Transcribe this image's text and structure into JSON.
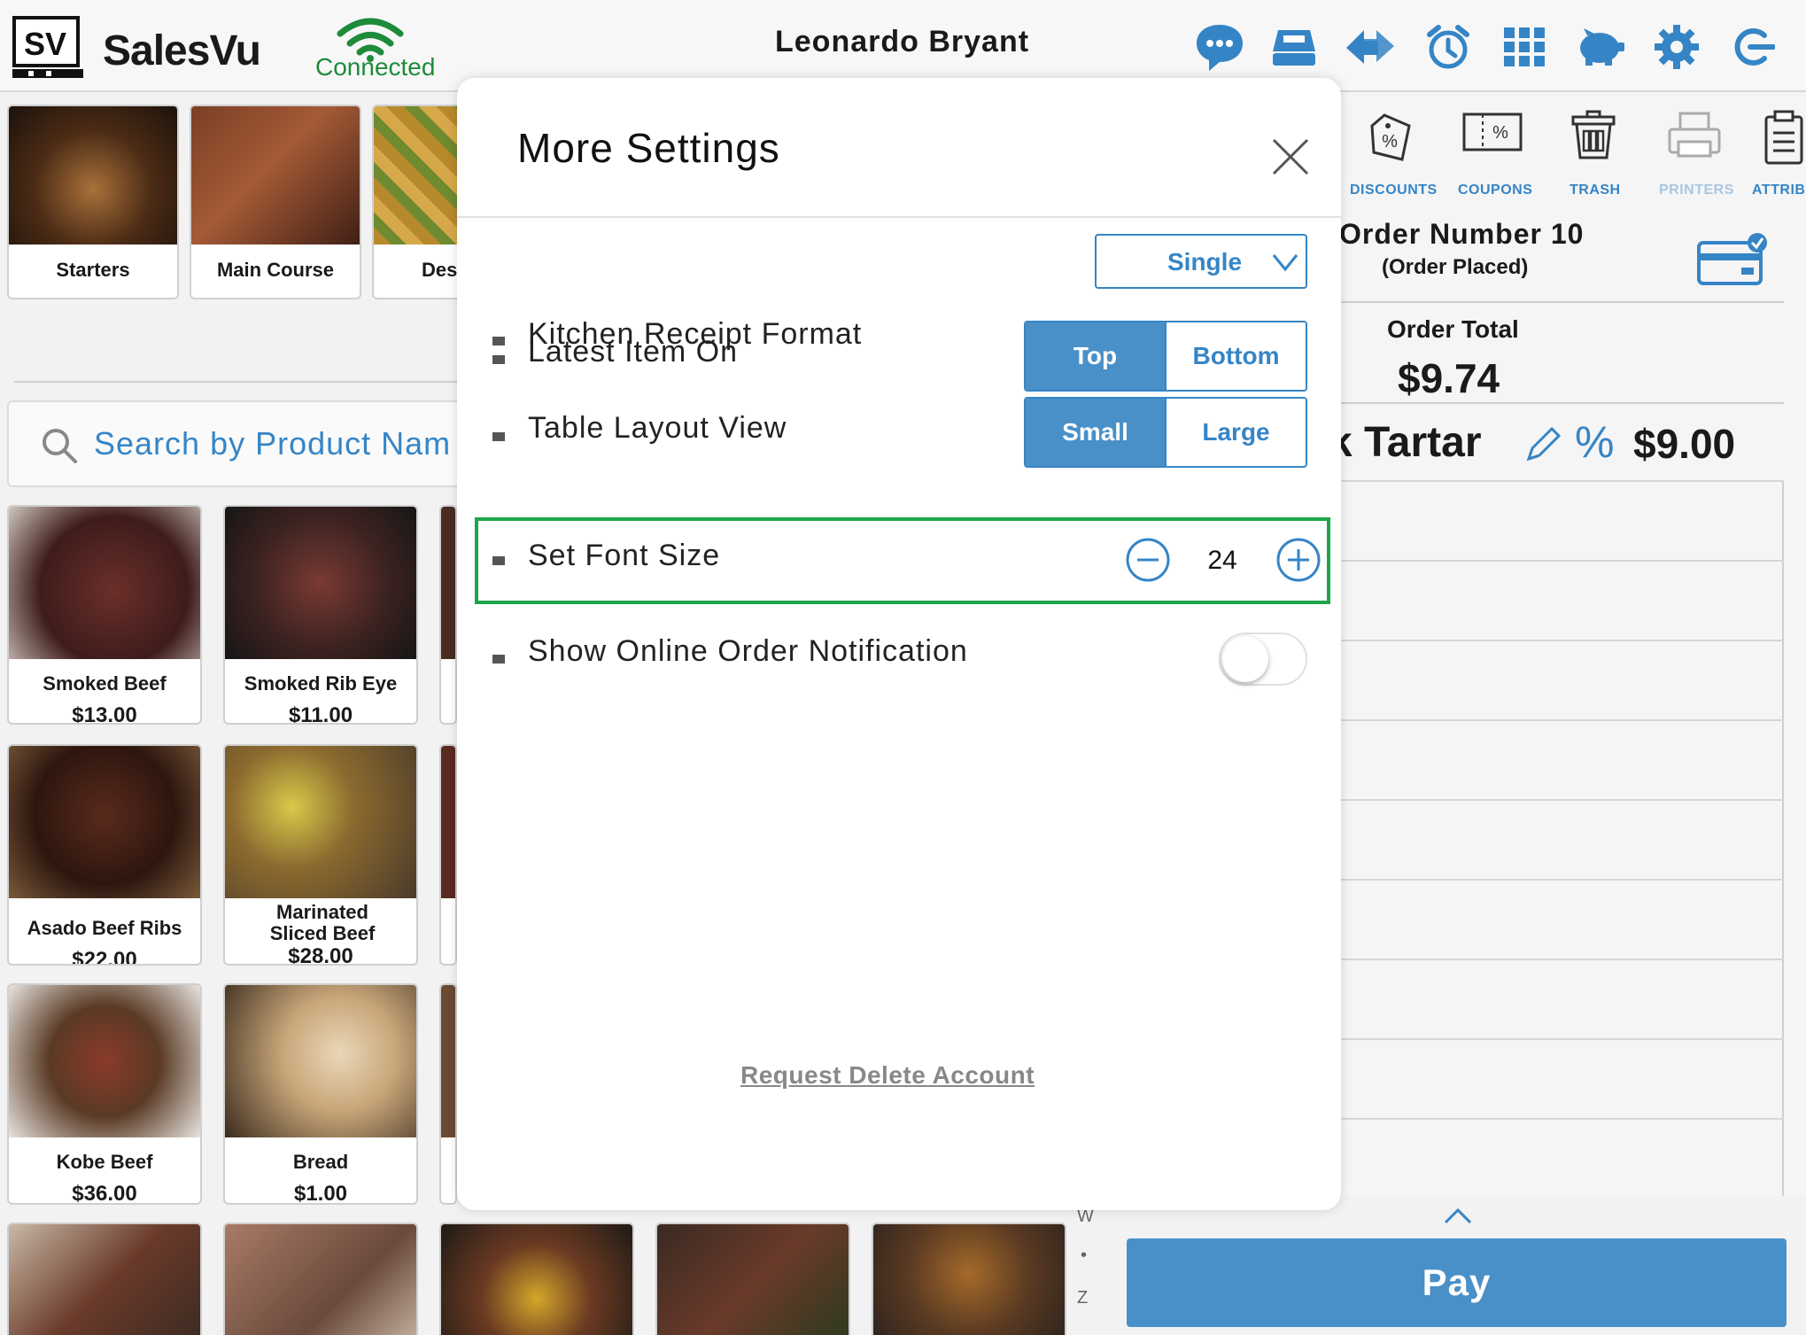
{
  "header": {
    "logo_mark": "SV",
    "brand": "SalesVu",
    "connection_status": "Connected",
    "user_name": "Leonardo Bryant",
    "icons": [
      "chat-icon",
      "register-icon",
      "swap-icon",
      "alarm-icon",
      "grid-icon",
      "piggy-bank-icon",
      "gear-icon",
      "logout-icon"
    ]
  },
  "categories": [
    {
      "label": "Starters"
    },
    {
      "label": "Main Course"
    },
    {
      "label": "Des"
    }
  ],
  "search": {
    "placeholder": "Search by Product Nam"
  },
  "products": [
    {
      "name": "Smoked Beef",
      "price": "$13.00"
    },
    {
      "name": "Smoked Rib Eye",
      "price": "$11.00"
    },
    {
      "name": "Asado Beef Ribs",
      "price": "$22.00"
    },
    {
      "name": "Marinated Sliced Beef",
      "price": "$28.00"
    },
    {
      "name": "Kobe Beef",
      "price": "$36.00"
    },
    {
      "name": "Bread",
      "price": "$1.00"
    }
  ],
  "alphabet_index": [
    "W",
    "•",
    "Z"
  ],
  "toolbar": {
    "discounts": "DISCOUNTS",
    "coupons": "COUPONS",
    "trash": "TRASH",
    "printers": "PRINTERS",
    "attributes": "ATTRIBU"
  },
  "order": {
    "title": "Order Number 10",
    "status": "(Order Placed)",
    "total_label": "Order Total",
    "total_value": "$9.74",
    "item_name": "k Tartar",
    "item_discount_symbol": "%",
    "item_price": "$9.00"
  },
  "pay_label": "Pay",
  "modal": {
    "title": "More Settings",
    "rows": {
      "kitchen_receipt": {
        "label": "Kitchen Receipt Format",
        "value": "Single"
      },
      "latest_item": {
        "label": "Latest Item On",
        "options": [
          "Top",
          "Bottom"
        ],
        "selected": "Top"
      },
      "table_layout": {
        "label": "Table Layout View",
        "options": [
          "Small",
          "Large"
        ],
        "selected": "Small"
      },
      "font_size": {
        "label": "Set Font Size",
        "value": "24"
      },
      "online_notification": {
        "label": "Show Online Order Notification",
        "enabled": false
      }
    },
    "delete_account": "Request Delete Account"
  },
  "colors": {
    "accent": "#3585c6",
    "pay": "#4a90c8",
    "connected": "#1e8b3a",
    "highlight": "#1ea54b"
  }
}
